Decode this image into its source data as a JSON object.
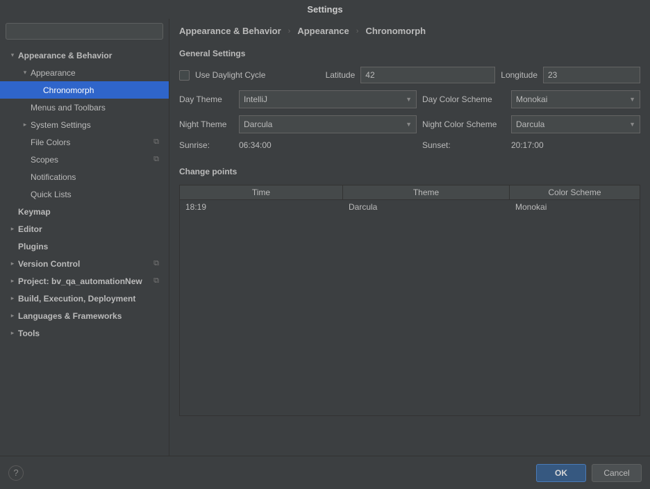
{
  "title": "Settings",
  "breadcrumb": [
    "Appearance & Behavior",
    "Appearance",
    "Chronomorph"
  ],
  "sidebar": {
    "search_placeholder": "",
    "items": [
      {
        "label": "Appearance & Behavior",
        "level": 0,
        "arrow": "▾",
        "bold": true
      },
      {
        "label": "Appearance",
        "level": 1,
        "arrow": "▾",
        "bold": false
      },
      {
        "label": "Chronomorph",
        "level": 2,
        "arrow": "",
        "bold": false,
        "selected": true
      },
      {
        "label": "Menus and Toolbars",
        "level": 1,
        "arrow": "",
        "bold": false
      },
      {
        "label": "System Settings",
        "level": 1,
        "arrow": "▸",
        "bold": false
      },
      {
        "label": "File Colors",
        "level": 1,
        "arrow": "",
        "bold": false,
        "badge": "⧉"
      },
      {
        "label": "Scopes",
        "level": 1,
        "arrow": "",
        "bold": false,
        "badge": "⧉"
      },
      {
        "label": "Notifications",
        "level": 1,
        "arrow": "",
        "bold": false
      },
      {
        "label": "Quick Lists",
        "level": 1,
        "arrow": "",
        "bold": false
      },
      {
        "label": "Keymap",
        "level": 0,
        "arrow": "",
        "bold": true
      },
      {
        "label": "Editor",
        "level": 0,
        "arrow": "▸",
        "bold": true
      },
      {
        "label": "Plugins",
        "level": 0,
        "arrow": "",
        "bold": true
      },
      {
        "label": "Version Control",
        "level": 0,
        "arrow": "▸",
        "bold": true,
        "badge": "⧉"
      },
      {
        "label": "Project: bv_qa_automationNew",
        "level": 0,
        "arrow": "▸",
        "bold": true,
        "badge": "⧉"
      },
      {
        "label": "Build, Execution, Deployment",
        "level": 0,
        "arrow": "▸",
        "bold": true
      },
      {
        "label": "Languages & Frameworks",
        "level": 0,
        "arrow": "▸",
        "bold": true
      },
      {
        "label": "Tools",
        "level": 0,
        "arrow": "▸",
        "bold": true
      }
    ]
  },
  "general": {
    "section_label": "General Settings",
    "use_daylight_label": "Use Daylight Cycle",
    "latitude_label": "Latitude",
    "latitude_value": "42",
    "longitude_label": "Longitude",
    "longitude_value": "23",
    "day_theme_label": "Day Theme",
    "day_theme_value": "IntelliJ",
    "day_scheme_label": "Day Color Scheme",
    "day_scheme_value": "Monokai",
    "night_theme_label": "Night Theme",
    "night_theme_value": "Darcula",
    "night_scheme_label": "Night Color Scheme",
    "night_scheme_value": "Darcula",
    "sunrise_label": "Sunrise:",
    "sunrise_value": "06:34:00",
    "sunset_label": "Sunset:",
    "sunset_value": "20:17:00"
  },
  "changepoints": {
    "section_label": "Change points",
    "headers": {
      "time": "Time",
      "theme": "Theme",
      "scheme": "Color Scheme"
    },
    "rows": [
      {
        "time": "18:19",
        "theme": "Darcula",
        "scheme": "Monokai"
      }
    ]
  },
  "footer": {
    "help": "?",
    "ok": "OK",
    "cancel": "Cancel"
  }
}
